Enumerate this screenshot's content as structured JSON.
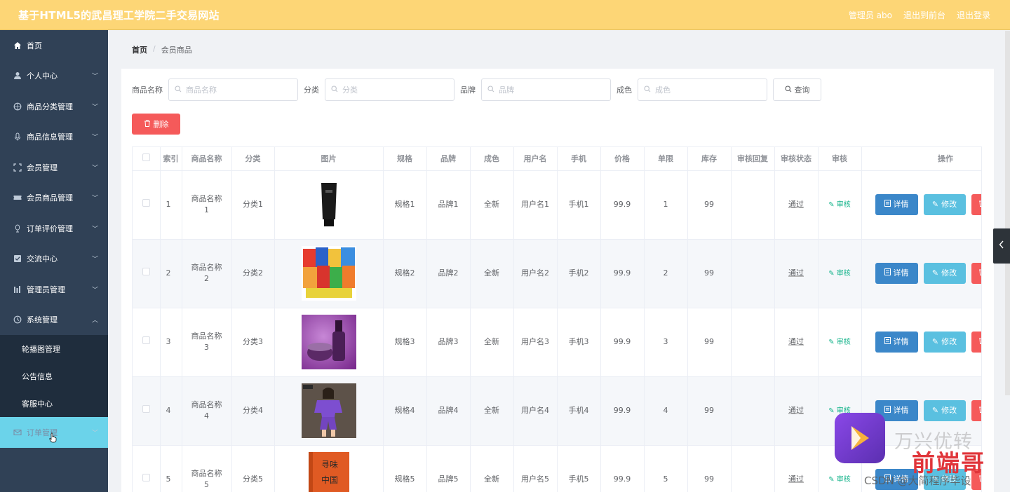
{
  "header": {
    "title": "基于HTML5的武昌理工学院二手交易网站",
    "links": [
      "管理员 abo",
      "退出到前台",
      "退出登录"
    ]
  },
  "sidebar": {
    "items": [
      {
        "label": "首页",
        "icon": "home-icon"
      },
      {
        "label": "个人中心",
        "icon": "user-icon"
      },
      {
        "label": "商品分类管理",
        "icon": "category-icon"
      },
      {
        "label": "商品信息管理",
        "icon": "mic-icon"
      },
      {
        "label": "会员管理",
        "icon": "scan-icon"
      },
      {
        "label": "会员商品管理",
        "icon": "ticket-icon"
      },
      {
        "label": "订单评价管理",
        "icon": "microphone-icon"
      },
      {
        "label": "交流中心",
        "icon": "checked-icon"
      },
      {
        "label": "管理员管理",
        "icon": "chart-icon"
      },
      {
        "label": "系统管理",
        "icon": "clock-icon"
      }
    ],
    "subitems": [
      "轮播图管理",
      "公告信息",
      "客服中心"
    ],
    "active_item": {
      "label": "订单管理",
      "icon": "mail-icon"
    }
  },
  "breadcrumb": {
    "home": "首页",
    "sep": "/",
    "current": "会员商品"
  },
  "search": {
    "fields": [
      {
        "label": "商品名称",
        "placeholder": "商品名称"
      },
      {
        "label": "分类",
        "placeholder": "分类"
      },
      {
        "label": "品牌",
        "placeholder": "品牌"
      },
      {
        "label": "成色",
        "placeholder": "成色"
      }
    ],
    "query_label": "查询"
  },
  "delete_label": "删除",
  "table": {
    "headers": [
      "索引",
      "商品名称",
      "分类",
      "图片",
      "规格",
      "品牌",
      "成色",
      "用户名",
      "手机",
      "价格",
      "单限",
      "库存",
      "审核回复",
      "审核状态",
      "审核",
      "操作"
    ],
    "rows": [
      {
        "index": "1",
        "name_line1": "商品名称",
        "name_line2": "1",
        "category": "分类1",
        "spec": "规格1",
        "brand": "品牌1",
        "condition": "全新",
        "username": "用户名1",
        "phone": "手机1",
        "price": "99.9",
        "limit": "1",
        "stock": "99",
        "reply": "",
        "status": "通过",
        "audit": "审核",
        "image": "black-tube-product"
      },
      {
        "index": "2",
        "name_line1": "商品名称",
        "name_line2": "2",
        "category": "分类2",
        "spec": "规格2",
        "brand": "品牌2",
        "condition": "全新",
        "username": "用户名2",
        "phone": "手机2",
        "price": "99.9",
        "limit": "2",
        "stock": "99",
        "reply": "",
        "status": "通过",
        "audit": "审核",
        "image": "snack-bags-product"
      },
      {
        "index": "3",
        "name_line1": "商品名称",
        "name_line2": "3",
        "category": "分类3",
        "spec": "规格3",
        "brand": "品牌3",
        "condition": "全新",
        "username": "用户名3",
        "phone": "手机3",
        "price": "99.9",
        "limit": "3",
        "stock": "99",
        "reply": "",
        "status": "通过",
        "audit": "审核",
        "image": "cosmetics-product"
      },
      {
        "index": "4",
        "name_line1": "商品名称",
        "name_line2": "4",
        "category": "分类4",
        "spec": "规格4",
        "brand": "品牌4",
        "condition": "全新",
        "username": "用户名4",
        "phone": "手机4",
        "price": "99.9",
        "limit": "4",
        "stock": "99",
        "reply": "",
        "status": "通过",
        "audit": "审核",
        "image": "purple-outfit-product"
      },
      {
        "index": "5",
        "name_line1": "商品名称",
        "name_line2": "5",
        "category": "分类5",
        "spec": "规格5",
        "brand": "品牌5",
        "condition": "全新",
        "username": "用户名5",
        "phone": "手机5",
        "price": "99.9",
        "limit": "5",
        "stock": "99",
        "reply": "",
        "status": "通过",
        "audit": "审核",
        "image": "orange-book-product"
      }
    ],
    "ops": {
      "detail": "详情",
      "edit": "修改"
    }
  },
  "watermark": {
    "brand": "万兴优转",
    "author": "前端哥",
    "csdn": "CSDN @大简程序毕设"
  },
  "colors": {
    "header_bg": "#fdd676",
    "sidebar_bg": "#304156",
    "active_menu": "#6bd3ea",
    "detail_btn": "#3b87c9",
    "edit_btn": "#5ac0e0",
    "danger": "#f55a5a",
    "audit_green": "#13b38a"
  }
}
